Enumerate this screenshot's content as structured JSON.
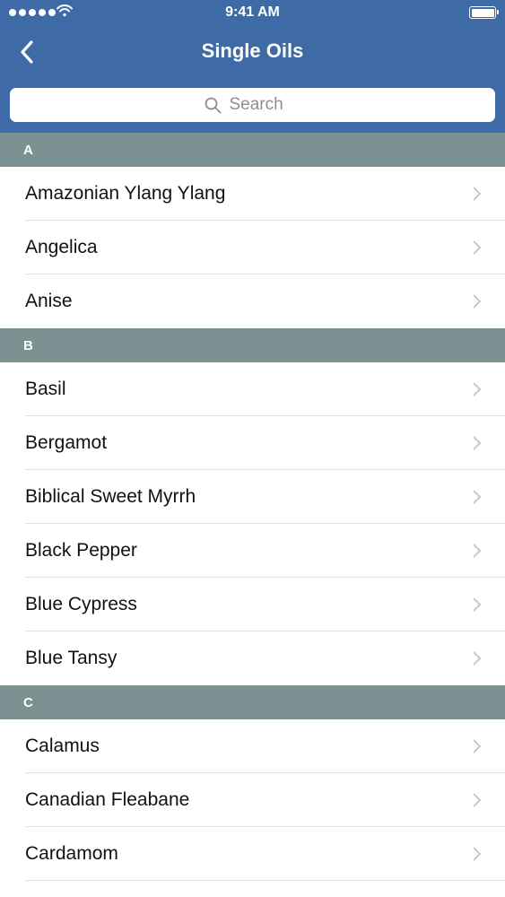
{
  "status_bar": {
    "time": "9:41 AM"
  },
  "nav": {
    "title": "Single Oils"
  },
  "search": {
    "placeholder": "Search"
  },
  "sections": [
    {
      "letter": "A",
      "items": [
        "Amazonian Ylang Ylang",
        "Angelica",
        "Anise"
      ]
    },
    {
      "letter": "B",
      "items": [
        "Basil",
        "Bergamot",
        "Biblical Sweet Myrrh",
        "Black Pepper",
        "Blue Cypress",
        "Blue Tansy"
      ]
    },
    {
      "letter": "C",
      "items": [
        "Calamus",
        "Canadian Fleabane",
        "Cardamom"
      ]
    }
  ],
  "colors": {
    "nav_background": "#3e6aa6",
    "section_header": "#7b9192",
    "chevron": "#c7c7cc"
  }
}
